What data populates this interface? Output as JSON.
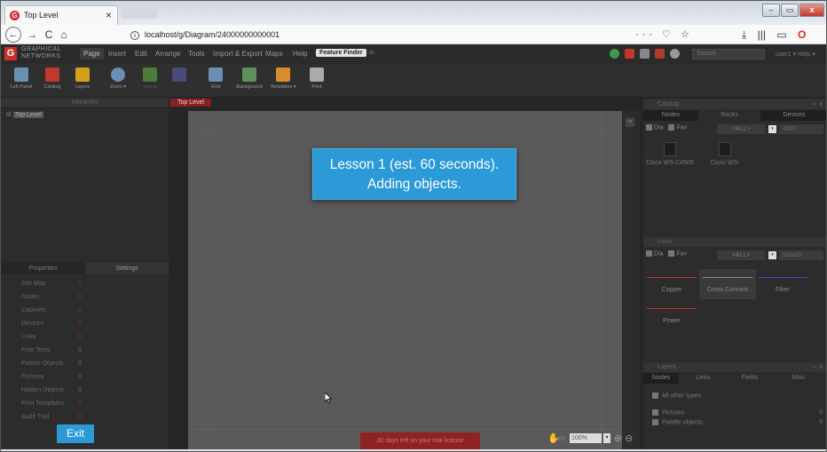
{
  "browser": {
    "tab_title": "Top Level",
    "tab_close": "×",
    "ghost_tab": "",
    "window_buttons": [
      "–",
      "▭",
      "x"
    ],
    "nav": {
      "back": "←",
      "forward": "→",
      "reload": "C",
      "home": "⌂"
    },
    "url": "localhost/g/Diagram/24000000000001",
    "url_right": "··· ♡ ☆",
    "nav_right": [
      "⤓",
      "|||",
      "▭",
      "O",
      "≡"
    ]
  },
  "app": {
    "logo": "G",
    "brand_line1": "GRAPHICAL",
    "brand_line2": "NETWORKS",
    "menu": [
      "Page",
      "Insert",
      "Edit",
      "Arrange",
      "Tools",
      "Import & Export",
      "Maps",
      "Help"
    ],
    "feature_finder": "Feature Finder",
    "feature_caret": "≐",
    "search_placeholder": "Search",
    "user": "user1 ▾ Help ▾"
  },
  "toolbar": {
    "tools": [
      {
        "label": "Left Panel",
        "color": "#6a8fb5"
      },
      {
        "label": "Catalog",
        "color": "#c0392b"
      },
      {
        "label": "Layers",
        "color": "#d4a017"
      },
      {
        "label": "Zoom ▾",
        "color": "#6a8fb5"
      },
      {
        "label": "Select",
        "color": "#4e7a3a"
      },
      {
        "label": "",
        "color": "#4a4a7a"
      },
      {
        "label": "Grid",
        "color": "#6a8fb5"
      },
      {
        "label": "Background",
        "color": "#5f8f5f"
      },
      {
        "label": "Templates ▾",
        "color": "#d98c2b"
      },
      {
        "label": "Print",
        "color": "#aaaaaa"
      }
    ]
  },
  "left": {
    "hierarchy_title": "Hierarchy",
    "tree_root": "Top Level",
    "props_tab": "Properties",
    "settings_tab": "Settings",
    "props": [
      {
        "name": "Site Map",
        "value": "0",
        "red": true
      },
      {
        "name": "Nodes",
        "value": "0",
        "red": true
      },
      {
        "name": "Cabinets",
        "value": "0",
        "red": true
      },
      {
        "name": "Devices",
        "value": "0",
        "red": true
      },
      {
        "name": "Links",
        "value": "0",
        "red": true
      },
      {
        "name": "Free Texts",
        "value": "0",
        "red": false
      },
      {
        "name": "Palette Objects",
        "value": "0",
        "red": false
      },
      {
        "name": "Pictures",
        "value": "0",
        "red": false
      },
      {
        "name": "Hidden Objects",
        "value": "0",
        "red": false
      },
      {
        "name": "Print Templates",
        "value": "0",
        "red": true
      },
      {
        "name": "Audit Trail",
        "value": "0",
        "red": true
      }
    ],
    "exit": "Exit"
  },
  "canvas": {
    "tab": "Top Level",
    "lesson_line1": "Lesson 1 (est. 60 seconds).",
    "lesson_line2": "Adding objects.",
    "trial": "30 days left on your trial license",
    "zoom": "100%",
    "scroll_btn": "≡"
  },
  "right": {
    "catalog_title": "Catalog",
    "catalog_tabs": [
      "Nodes",
      "Racks",
      "Devices"
    ],
    "filter_dia": "Dia",
    "filter_fav": "Fav",
    "filter_all": "<ALL>",
    "catalog_search": "4506",
    "catalog_items": [
      "Cisco WS-C4506",
      "Cisco WS-"
    ],
    "links_title": "Links",
    "links_search": "Search",
    "links": [
      {
        "label": "Copper",
        "color": "#c0392b"
      },
      {
        "label": "Cross Connect",
        "color": "#888888"
      },
      {
        "label": "Fiber",
        "color": "#3a4fc4"
      },
      {
        "label": "Power",
        "color": "#c0392b"
      }
    ],
    "layers_title": "Layers",
    "layers_tabs": [
      "Nodes",
      "Links",
      "Fields",
      "Misc"
    ],
    "layers_rows": [
      {
        "label": "All other types",
        "count": ""
      },
      {
        "label": "Pictures",
        "count": "0"
      },
      {
        "label": "Palette objects",
        "count": "0"
      }
    ],
    "panel_ctrl": "⇔ x"
  },
  "colors": {
    "accent": "#2b9ad6",
    "brand_red": "#c9302c"
  }
}
